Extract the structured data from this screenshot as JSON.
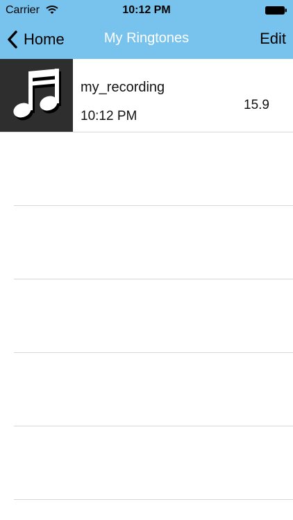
{
  "status_bar": {
    "carrier": "Carrier",
    "time": "10:12 PM"
  },
  "nav": {
    "back_label": "Home",
    "title": "My Ringtones",
    "edit_label": "Edit"
  },
  "colors": {
    "header_background": "#77c3ee",
    "title_text": "#ffffff",
    "thumbnail_background": "#2e2e2e"
  },
  "ringtones": [
    {
      "name": "my_recording",
      "time": "10:12 PM",
      "value": "15.9",
      "icon": "music-note-icon"
    }
  ]
}
